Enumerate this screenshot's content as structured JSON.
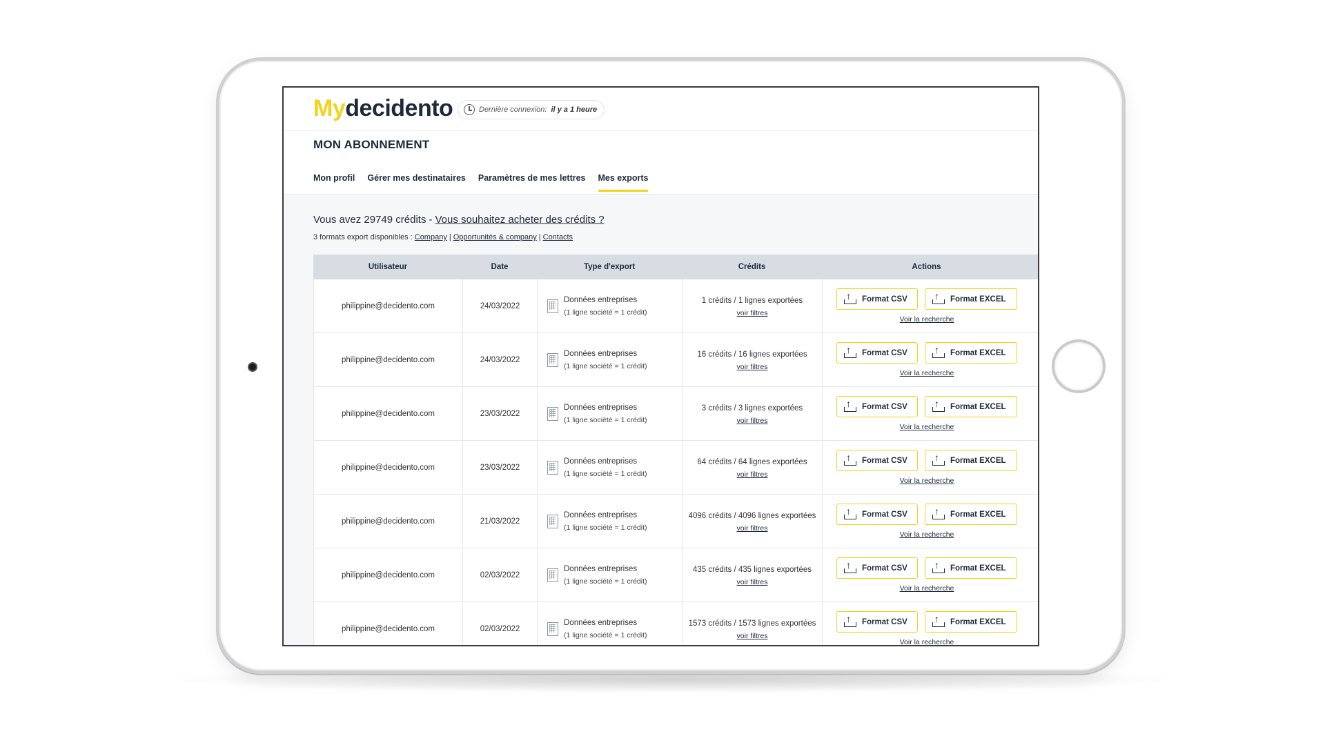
{
  "header": {
    "logo_my": "My",
    "logo_brand": "decidento",
    "last_login_label": "Dernière connexion:",
    "last_login_value": "il y a 1 heure"
  },
  "page_title": "MON ABONNEMENT",
  "tabs": [
    {
      "label": "Mon profil",
      "active": false
    },
    {
      "label": "Gérer mes destinataires",
      "active": false
    },
    {
      "label": "Paramètres de mes lettres",
      "active": false
    },
    {
      "label": "Mes exports",
      "active": true
    }
  ],
  "credits": {
    "text": "Vous avez 29749 crédits",
    "dash": "-",
    "buy_link": "Vous souhaitez acheter des crédits ?"
  },
  "formats": {
    "label": "3 formats export disponibles :",
    "links": [
      "Company",
      "Opportunités & company",
      "Contacts"
    ],
    "separator": "|"
  },
  "table": {
    "headers": [
      "Utilisateur",
      "Date",
      "Type d'export",
      "Crédits",
      "Actions"
    ],
    "csv_label": "Format CSV",
    "excel_label": "Format EXCEL",
    "see_filters": "voir filtres",
    "see_search": "Voir la recherche",
    "rows": [
      {
        "user": "philippine@decidento.com",
        "date": "24/03/2022",
        "type": "Données entreprises",
        "type_note": "(1 ligne société = 1 crédit)",
        "credits": "1 crédits / 1 lignes exportées"
      },
      {
        "user": "philippine@decidento.com",
        "date": "24/03/2022",
        "type": "Données entreprises",
        "type_note": "(1 ligne société = 1 crédit)",
        "credits": "16 crédits / 16 lignes exportées"
      },
      {
        "user": "philippine@decidento.com",
        "date": "23/03/2022",
        "type": "Données entreprises",
        "type_note": "(1 ligne société = 1 crédit)",
        "credits": "3 crédits / 3 lignes exportées"
      },
      {
        "user": "philippine@decidento.com",
        "date": "23/03/2022",
        "type": "Données entreprises",
        "type_note": "(1 ligne société = 1 crédit)",
        "credits": "64 crédits / 64 lignes exportées"
      },
      {
        "user": "philippine@decidento.com",
        "date": "21/03/2022",
        "type": "Données entreprises",
        "type_note": "(1 ligne société = 1 crédit)",
        "credits": "4096 crédits / 4096 lignes exportées"
      },
      {
        "user": "philippine@decidento.com",
        "date": "02/03/2022",
        "type": "Données entreprises",
        "type_note": "(1 ligne société = 1 crédit)",
        "credits": "435 crédits / 435 lignes exportées"
      },
      {
        "user": "philippine@decidento.com",
        "date": "02/03/2022",
        "type": "Données entreprises",
        "type_note": "(1 ligne société = 1 crédit)",
        "credits": "1573 crédits / 1573 lignes exportées"
      }
    ]
  },
  "colors": {
    "accent": "#f2d21b",
    "text_dark": "#1e2a3a",
    "table_header_bg": "#d7dde2",
    "content_bg": "#f6f7f8"
  }
}
